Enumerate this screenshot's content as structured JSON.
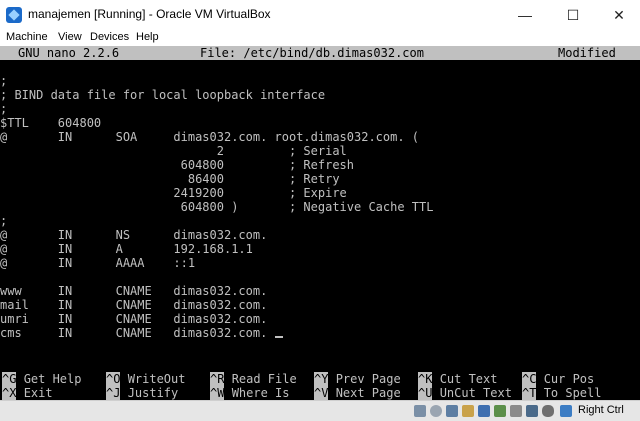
{
  "window": {
    "title": "manajemen [Running] - Oracle VM VirtualBox",
    "minimize_glyph": "—",
    "maximize_glyph": "☐",
    "close_glyph": "✕"
  },
  "menu": [
    "Machine",
    "View",
    "Devices",
    "Help"
  ],
  "nano": {
    "version": "GNU nano 2.2.6",
    "file": "File: /etc/bind/db.dimas032.com",
    "status": "Modified"
  },
  "editor_lines": [
    ";",
    "; BIND data file for local loopback interface",
    ";",
    "$TTL    604800",
    "@       IN      SOA     dimas032.com. root.dimas032.com. (",
    "                              2         ; Serial",
    "                         604800         ; Refresh",
    "                          86400         ; Retry",
    "                        2419200         ; Expire",
    "                         604800 )       ; Negative Cache TTL",
    ";",
    "@       IN      NS      dimas032.com.",
    "@       IN      A       192.168.1.1",
    "@       IN      AAAA    ::1",
    "",
    "www     IN      CNAME   dimas032.com.",
    "mail    IN      CNAME   dimas032.com.",
    "umri    IN      CNAME   dimas032.com.",
    "cms     IN      CNAME   dimas032.com. "
  ],
  "shortcuts_row1": [
    {
      "key": "^G",
      "label": "Get Help"
    },
    {
      "key": "^O",
      "label": "WriteOut"
    },
    {
      "key": "^R",
      "label": "Read File"
    },
    {
      "key": "^Y",
      "label": "Prev Page"
    },
    {
      "key": "^K",
      "label": "Cut Text"
    },
    {
      "key": "^C",
      "label": "Cur Pos"
    }
  ],
  "shortcuts_row2": [
    {
      "key": "^X",
      "label": "Exit"
    },
    {
      "key": "^J",
      "label": "Justify"
    },
    {
      "key": "^W",
      "label": "Where Is"
    },
    {
      "key": "^V",
      "label": "Next Page"
    },
    {
      "key": "^U",
      "label": "UnCut Text"
    },
    {
      "key": "^T",
      "label": "To Spell"
    }
  ],
  "statusbar": {
    "host_key": "Right Ctrl",
    "icons": [
      "hdd-icon",
      "optical-icon",
      "usb-icon",
      "shared-folder-icon",
      "display-icon",
      "network-icon",
      "video-capture-icon",
      "cpu-icon",
      "mouse-icon",
      "keyboard-icon"
    ]
  }
}
